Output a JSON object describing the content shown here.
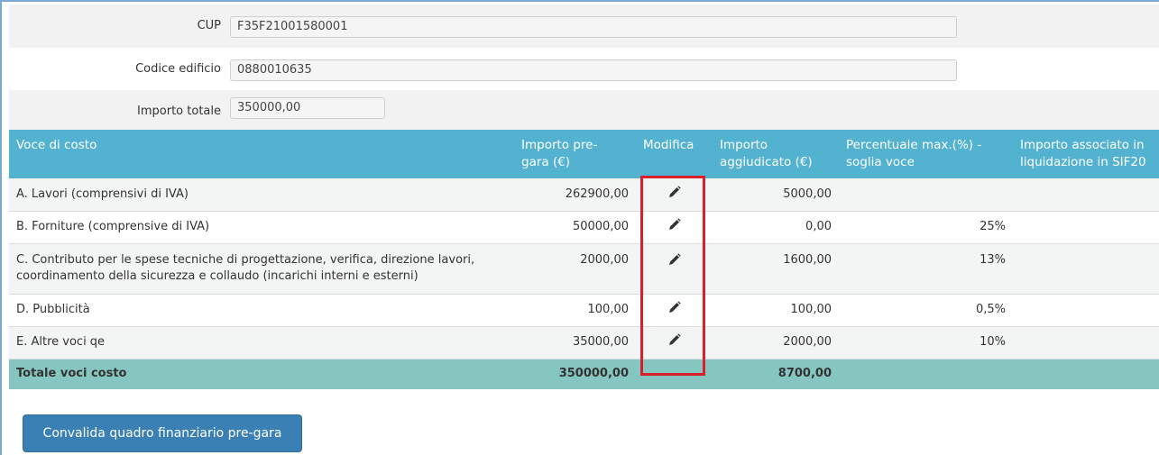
{
  "form": {
    "cup": {
      "label": "CUP",
      "value": "F35F21001580001"
    },
    "codice_edificio": {
      "label": "Codice edificio",
      "value": "0880010635"
    },
    "importo_totale": {
      "label": "Importo totale",
      "value": "350000,00"
    }
  },
  "table": {
    "headers": {
      "voce": "Voce di costo",
      "importo_pregara_1": "Importo pre-",
      "importo_pregara_2": "gara (€)",
      "modifica": "Modifica",
      "aggiudicato_1": "Importo",
      "aggiudicato_2": "aggiudicato (€)",
      "perc_1": "Percentuale max.(%) -",
      "perc_2": "soglia voce",
      "assoc_1": "Importo associato in",
      "assoc_2": "liquidazione in SIF20"
    },
    "rows": [
      {
        "voce_1": "A. Lavori (comprensivi di IVA)",
        "voce_2": "",
        "pregara": "262900,00",
        "aggiudicato": "5000,00",
        "perc": "",
        "assoc": ""
      },
      {
        "voce_1": "B. Forniture (comprensive di IVA)",
        "voce_2": "",
        "pregara": "50000,00",
        "aggiudicato": "0,00",
        "perc": "25%",
        "assoc": ""
      },
      {
        "voce_1": "C. Contributo per le spese tecniche di progettazione, verifica, direzione lavori,",
        "voce_2": "coordinamento della sicurezza e collaudo (incarichi interni e esterni)",
        "pregara": "2000,00",
        "aggiudicato": "1600,00",
        "perc": "13%",
        "assoc": ""
      },
      {
        "voce_1": "D. Pubblicità",
        "voce_2": "",
        "pregara": "100,00",
        "aggiudicato": "100,00",
        "perc": "0,5%",
        "assoc": ""
      },
      {
        "voce_1": "E. Altre voci qe",
        "voce_2": "",
        "pregara": "35000,00",
        "aggiudicato": "2000,00",
        "perc": "10%",
        "assoc": ""
      }
    ],
    "total": {
      "label": "Totale voci costo",
      "pregara": "350000,00",
      "aggiudicato": "8700,00"
    },
    "edit_icon": "pencil-icon"
  },
  "actions": {
    "convalida_label": "Convalida quadro finanziario pre-gara"
  },
  "colors": {
    "header": "#52b2d0",
    "total_row": "#86c6c0",
    "button": "#3a80b5",
    "highlight": "#d7202a"
  }
}
